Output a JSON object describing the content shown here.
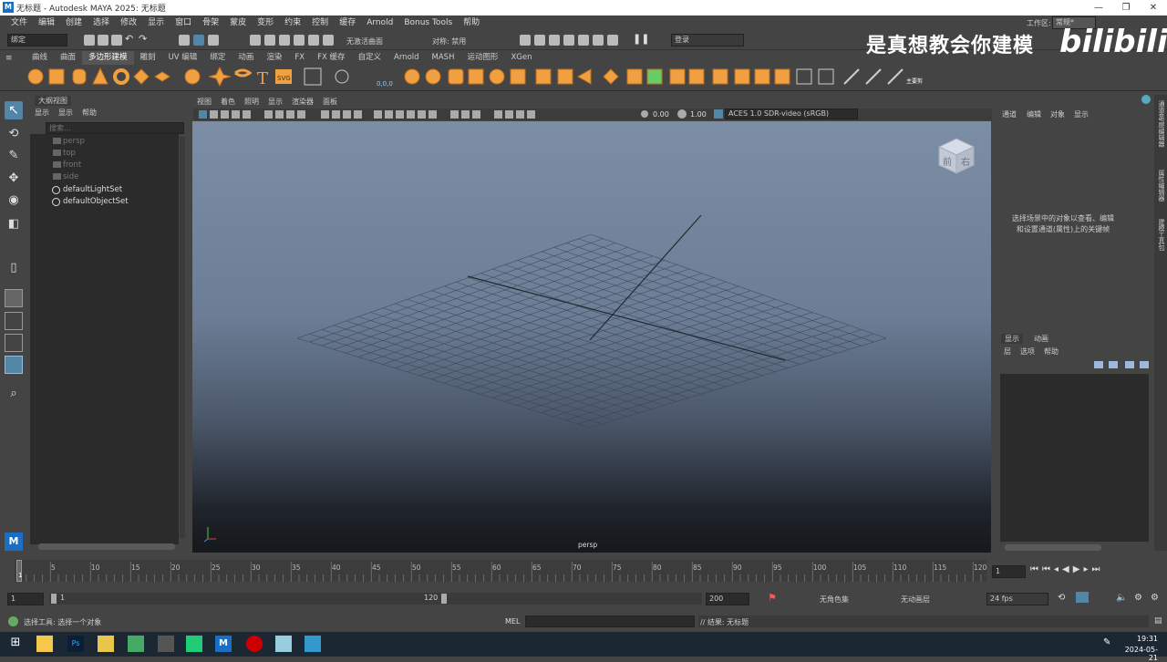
{
  "title_bar": {
    "logo": "M",
    "title": "无标题 - Autodesk MAYA 2025: 无标题"
  },
  "menu": [
    "文件",
    "编辑",
    "创建",
    "选择",
    "修改",
    "显示",
    "窗口",
    "骨架",
    "蒙皮",
    "变形",
    "约束",
    "控制",
    "缓存",
    "Arnold",
    "Bonus Tools",
    "帮助"
  ],
  "workspace": {
    "label": "工作区:",
    "value": "常规*"
  },
  "status_line": {
    "mode": "绑定",
    "live_surface": "无激活曲面",
    "symmetry": "对称: 禁用",
    "login": "登录"
  },
  "shelf_tabs": [
    "曲线",
    "曲面",
    "多边形建模",
    "雕刻",
    "UV 编辑",
    "绑定",
    "动画",
    "渲染",
    "FX",
    "FX 缓存",
    "自定义",
    "Arnold",
    "MASH",
    "运动图形",
    "XGen"
  ],
  "shelf_active": "多边形建模",
  "shelf_labels": {
    "svg": "SVG",
    "pos": "0,0,0",
    "motion_trail": "主要剪"
  },
  "outliner": {
    "title": "大纲视图",
    "menu": [
      "显示",
      "显示",
      "帮助"
    ],
    "search_placeholder": "搜索...",
    "items": [
      {
        "name": "persp",
        "dim": true
      },
      {
        "name": "top",
        "dim": true
      },
      {
        "name": "front",
        "dim": true
      },
      {
        "name": "side",
        "dim": true
      },
      {
        "name": "defaultLightSet",
        "dim": false
      },
      {
        "name": "defaultObjectSet",
        "dim": false
      }
    ]
  },
  "viewport": {
    "menu": [
      "视图",
      "着色",
      "照明",
      "显示",
      "渲染器",
      "面板"
    ],
    "exposure": "0.00",
    "gamma": "1.00",
    "color_space": "ACES 1.0 SDR-video (sRGB)",
    "camera_label": "persp",
    "viewcube_front": "前",
    "viewcube_right": "右"
  },
  "channel_box": {
    "menu": [
      "通道",
      "编辑",
      "对象",
      "显示"
    ],
    "hint": "选择场景中的对象以查看、编辑和设置通道(属性)上的关键帧"
  },
  "layer_editor": {
    "tabs": [
      "显示",
      "动画"
    ],
    "menu": [
      "层",
      "选项",
      "帮助"
    ]
  },
  "right_tabs": [
    "通道盒/层编辑器",
    "属性编辑器",
    "建模工具包"
  ],
  "timeline": {
    "ticks": [
      "5",
      "10",
      "15",
      "20",
      "25",
      "30",
      "35",
      "40",
      "45",
      "50",
      "55",
      "60",
      "65",
      "70",
      "75",
      "80",
      "85",
      "90",
      "95",
      "100",
      "105",
      "110",
      "115",
      "120"
    ],
    "current_frame_marker": "1",
    "current_frame": "1"
  },
  "range": {
    "start": "1",
    "inner_start": "1",
    "inner_end": "120",
    "end": "200",
    "character_set": "无角色集",
    "anim_layer": "无动画层",
    "fps": "24 fps"
  },
  "command_line": {
    "help_text": "选择工具: 选择一个对象",
    "lang": "MEL",
    "result": "// 结果: 无标题"
  },
  "taskbar": {
    "time": "19:31",
    "date": "2024-05-21"
  },
  "watermark": {
    "text": "是真想教会你建模",
    "brand": "bilibili"
  },
  "colors": {
    "accent": "#5285a6",
    "viewport_top": "#7c8ea6",
    "taskbar": "#1b2733",
    "shelf_orange": "#f0a040"
  }
}
